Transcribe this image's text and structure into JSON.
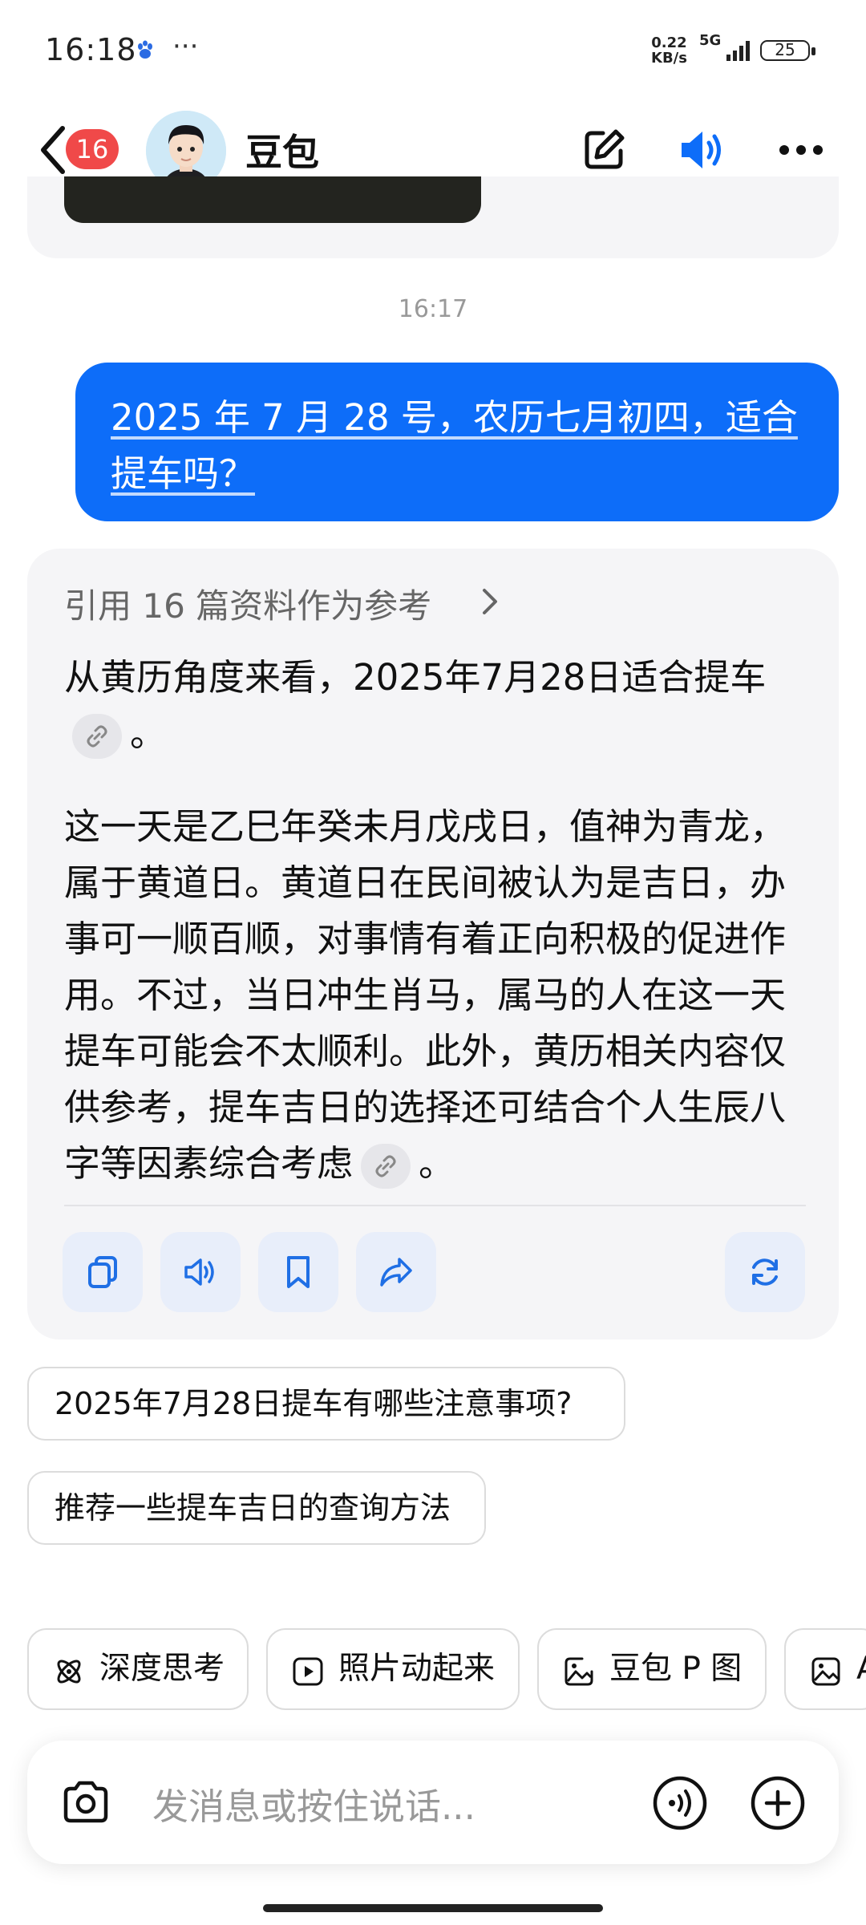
{
  "status_bar": {
    "time": "16:18",
    "dots": "···",
    "net_speed_value": "0.22",
    "net_speed_unit": "KB/s",
    "network": "5G",
    "battery": "25"
  },
  "header": {
    "unread_badge": "16",
    "title": "豆包"
  },
  "chat": {
    "timestamp": "16:17",
    "user_message": "2025 年 7 月 28 号，农历七月初四，适合提车吗？",
    "answer": {
      "reference_link": "引用 16 篇资料作为参考",
      "paragraph1": "从黄历角度来看，2025年7月28日适合提车",
      "paragraph1_end": "。",
      "paragraph2": "这一天是乙巳年癸未月戊戌日，值神为青龙，属于黄道日。黄道日在民间被认为是吉日，办事可一顺百顺，对事情有着正向积极的促进作用。不过，当日冲生肖马，属马的人在这一天提车可能会不太顺利。此外，黄历相关内容仅供参考，提车吉日的选择还可结合个人生辰八字等因素综合考虑",
      "paragraph2_end": "。"
    },
    "suggestions": [
      "2025年7月28日提车有哪些注意事项?",
      "推荐一些提车吉日的查询方法"
    ]
  },
  "quick_chips": [
    {
      "label": "深度思考",
      "icon": "atom-icon"
    },
    {
      "label": "照片动起来",
      "icon": "play-icon"
    },
    {
      "label": "豆包 P 图",
      "icon": "image-edit-icon"
    },
    {
      "label": "A",
      "icon": "image-icon"
    }
  ],
  "input": {
    "placeholder": "发消息或按住说话..."
  },
  "colors": {
    "accent": "#0d6df9",
    "badge": "#f04949",
    "card_bg": "#f5f5f7",
    "action_bg": "#e8eefa"
  }
}
